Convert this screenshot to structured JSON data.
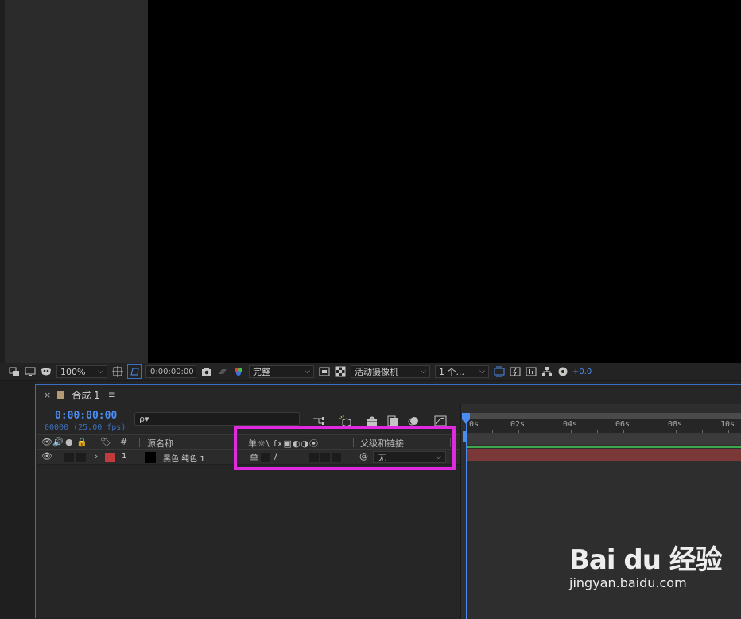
{
  "viewer_toolbar": {
    "zoom": "100%",
    "timecode": "0:00:00:00",
    "resolution": "完整",
    "camera": "活动摄像机",
    "views": "1 个...",
    "exposure": "+0.0"
  },
  "comp_panel": {
    "tab_close": "×",
    "tab_title": "合成 1",
    "tab_menu": "≡",
    "current_time": "0:00:00:00",
    "frames_fps": "00000 (25.00 fps)",
    "search_placeholder": "ρ▾"
  },
  "columns": {
    "number": "#",
    "source_name": "源名称",
    "parent_link": "父级和链接",
    "switch_glyphs": "单☼\\ fx▣◐◑⦿"
  },
  "layer": {
    "index": "1",
    "name": "黑色 纯色 1",
    "parent": "无",
    "label_color": "#c23b3b",
    "switch_shy": "单",
    "switch_quality": "/"
  },
  "ruler": {
    "labels": [
      "0s",
      "02s",
      "04s",
      "06s",
      "08s",
      "10s"
    ]
  },
  "watermark": {
    "logo": "Bai du 经验",
    "url": "jingyan.baidu.com"
  }
}
